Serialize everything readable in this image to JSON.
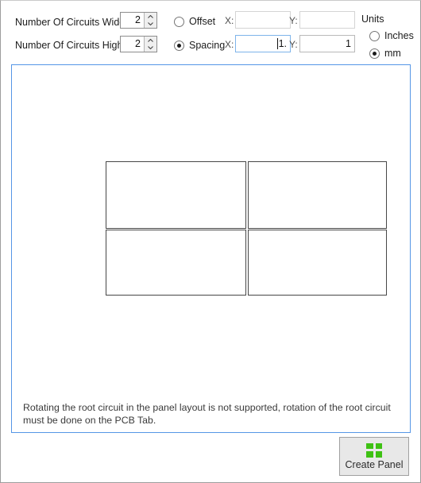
{
  "settings": {
    "wide": {
      "label": "Number Of Circuits Wide",
      "value": "2"
    },
    "high": {
      "label": "Number Of Circuits High",
      "value": "2"
    },
    "mode": {
      "offset_label": "Offset",
      "offset_selected": false,
      "spacing_label": "Spacing",
      "spacing_selected": true
    },
    "offset_fields": {
      "x_label": "X:",
      "x_value": "",
      "y_label": "Y:",
      "y_value": ""
    },
    "spacing_fields": {
      "x_label": "X:",
      "x_value": "1.",
      "y_label": "Y:",
      "y_value": "1"
    },
    "units": {
      "title": "Units",
      "inches_label": "Inches",
      "inches_selected": false,
      "mm_label": "mm",
      "mm_selected": true
    }
  },
  "canvas": {
    "note": "Rotating the root circuit in the panel layout is not supported, rotation of the root circuit must be done on the PCB Tab.",
    "grid": {
      "columns": 2,
      "rows": 2,
      "outline_color": "#474747"
    }
  },
  "footer": {
    "create_button_label": "Create Panel",
    "create_button_icon": "grid-2x2-icon",
    "icon_color": "#3ec113"
  }
}
